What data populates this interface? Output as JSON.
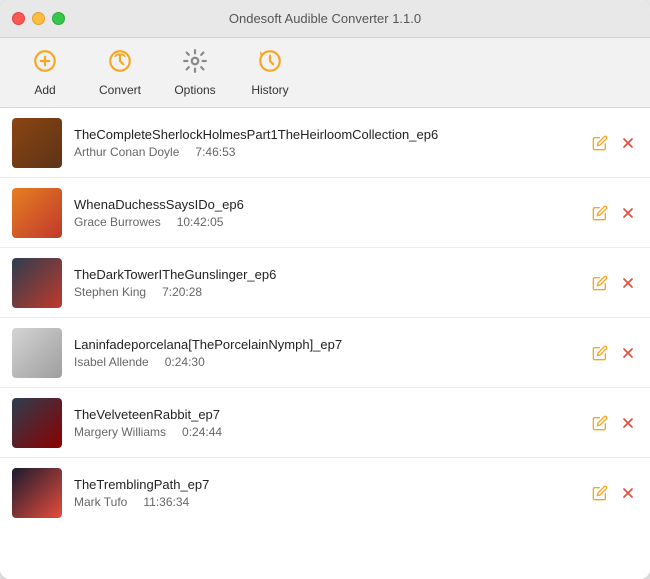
{
  "window": {
    "title": "Ondesoft Audible Converter 1.1.0"
  },
  "toolbar": {
    "buttons": [
      {
        "id": "add",
        "label": "Add",
        "icon": "add"
      },
      {
        "id": "convert",
        "label": "Convert",
        "icon": "convert"
      },
      {
        "id": "options",
        "label": "Options",
        "icon": "options"
      },
      {
        "id": "history",
        "label": "History",
        "icon": "history"
      }
    ]
  },
  "books": [
    {
      "title": "TheCompleteSherlockHolmesPart1TheHeirloomCollection_ep6",
      "author": "Arthur Conan Doyle",
      "duration": "7:46:53",
      "cover_color": "cover-1"
    },
    {
      "title": "WhenaDuchessSaysIDo_ep6",
      "author": "Grace Burrowes",
      "duration": "10:42:05",
      "cover_color": "cover-2"
    },
    {
      "title": "TheDarkTowerITheGunslinger_ep6",
      "author": "Stephen King",
      "duration": "7:20:28",
      "cover_color": "cover-3"
    },
    {
      "title": "Laninfadeporcelana[ThePorcelainNymph]_ep7",
      "author": "Isabel Allende",
      "duration": "0:24:30",
      "cover_color": "cover-4"
    },
    {
      "title": "TheVelveteenRabbit_ep7",
      "author": "Margery Williams",
      "duration": "0:24:44",
      "cover_color": "cover-5"
    },
    {
      "title": "TheTremblingPath_ep7",
      "author": "Mark Tufo",
      "duration": "11:36:34",
      "cover_color": "cover-6"
    }
  ],
  "actions": {
    "edit_icon": "✎",
    "delete_icon": "✕"
  }
}
